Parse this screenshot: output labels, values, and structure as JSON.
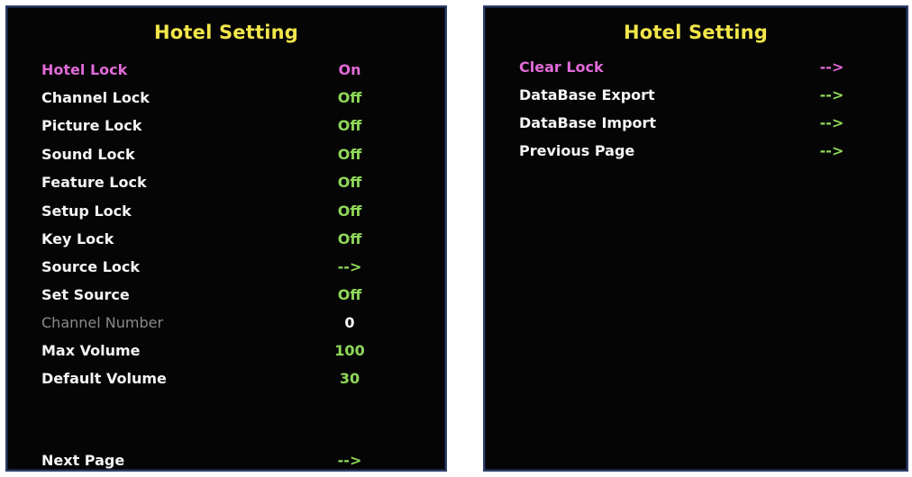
{
  "left_panel": {
    "title": "Hotel Setting",
    "items": [
      {
        "label": "Hotel Lock",
        "value": "On"
      },
      {
        "label": "Channel Lock",
        "value": "Off"
      },
      {
        "label": "Picture Lock",
        "value": "Off"
      },
      {
        "label": "Sound Lock",
        "value": "Off"
      },
      {
        "label": "Feature Lock",
        "value": "Off"
      },
      {
        "label": "Setup Lock",
        "value": "Off"
      },
      {
        "label": "Key Lock",
        "value": "Off"
      },
      {
        "label": "Source Lock",
        "value": "-->"
      },
      {
        "label": "Set Source",
        "value": "Off"
      },
      {
        "label": "Channel Number",
        "value": "0"
      },
      {
        "label": "Max Volume",
        "value": "100"
      },
      {
        "label": "Default Volume",
        "value": "30"
      }
    ],
    "next_page": {
      "label": "Next Page",
      "value": "-->"
    }
  },
  "right_panel": {
    "title": "Hotel Setting",
    "items": [
      {
        "label": "Clear Lock",
        "value": "-->"
      },
      {
        "label": "DataBase Export",
        "value": "-->"
      },
      {
        "label": "DataBase Import",
        "value": "-->"
      },
      {
        "label": "Previous Page",
        "value": "-->"
      }
    ]
  },
  "colors": {
    "title": "#f2e64a",
    "highlight": "#e06ad8",
    "label": "#f4f4f4",
    "value": "#8fd85a",
    "disabled": "#8a8a8a",
    "panel_background": "#050505",
    "panel_border": "#2f3f6a"
  }
}
